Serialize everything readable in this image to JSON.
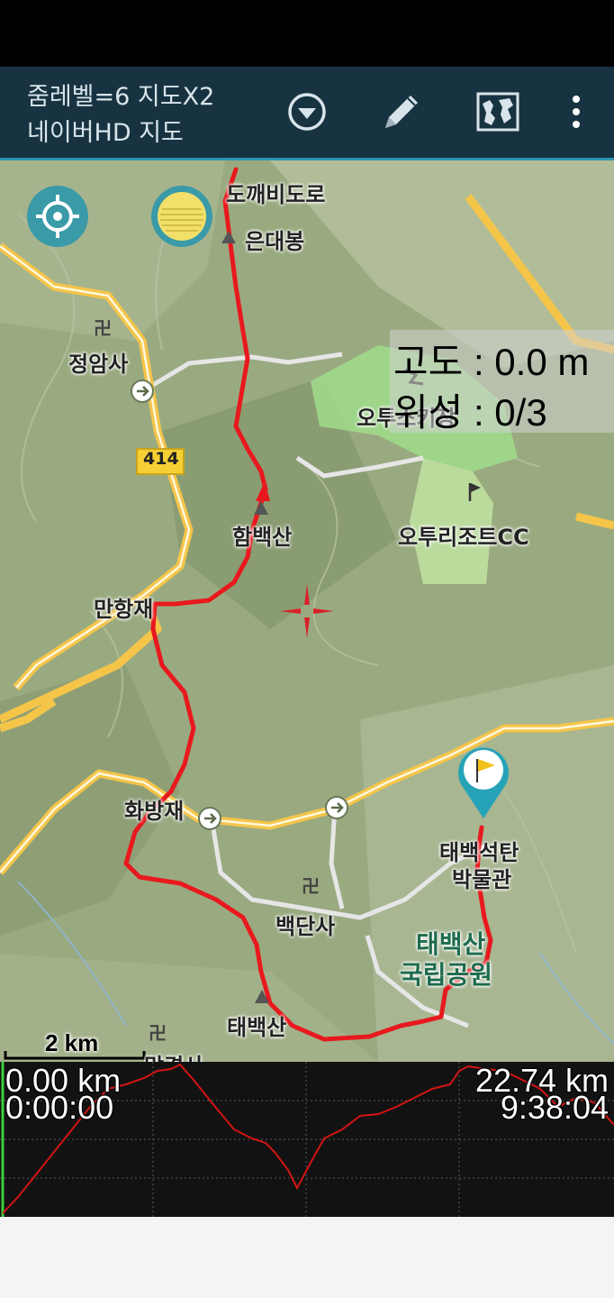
{
  "app_bar": {
    "title_line1": "줌레벨=6 지도X2",
    "title_line2": "네이버HD 지도",
    "icons": [
      "dropdown-icon",
      "pencil-icon",
      "map-icon",
      "more-vert-icon"
    ]
  },
  "info": {
    "altitude": "고도 : 0.0 m",
    "satellites": "위성 : 0/3"
  },
  "map": {
    "labels": {
      "dokkaebi": "도깨비도로",
      "eundaebong": "은대봉",
      "jeongamsa": "정암사",
      "road414": "414",
      "otu_ski": "오투스키장",
      "otu_resort": "오투리조트CC",
      "hambaeksan": "함백산",
      "manhangjae": "만항재",
      "hwabangjae": "화방재",
      "museum_1": "태백석탄",
      "museum_2": "박물관",
      "baekdansa": "백단사",
      "park_1": "태백산",
      "park_2": "국립공원",
      "taebaeksan": "태백산",
      "bottom_partial": "망경사"
    },
    "scale": "2 km",
    "colors": {
      "track": "#e8191e",
      "road": "#f5c54a",
      "forest": "#8ca06f",
      "ski": "#9fd98a"
    }
  },
  "profile": {
    "start_distance": "0.00 km",
    "start_time": "0:00:00",
    "end_distance": "22.74 km",
    "end_time": "9:38:04"
  }
}
